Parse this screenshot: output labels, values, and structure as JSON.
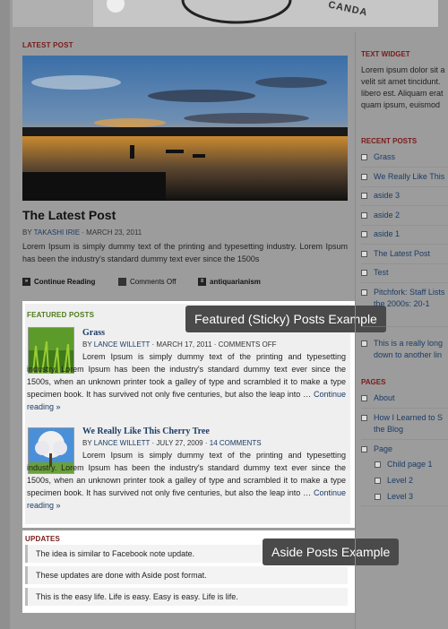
{
  "masthead": {
    "text": "CANDA"
  },
  "main": {
    "latest_label": "LATEST POST",
    "post": {
      "title": "The Latest Post",
      "by": "BY",
      "author": "TAKASHI IRIE",
      "date": "· MARCH 23, 2011",
      "excerpt": "Lorem Ipsum is simply dummy text of the printing and typesetting industry. Lorem Ipsum has been the industry's standard dummy text ever since the 1500s",
      "actions": {
        "continue": "Continue Reading",
        "comments": "Comments Off",
        "tag": "antiquarianism"
      }
    },
    "featured": {
      "label": "FEATURED POSTS",
      "callout": "Featured (Sticky) Posts Example",
      "items": [
        {
          "title": "Grass",
          "by": "BY",
          "author": "LANCE WILLETT",
          "date": "· MARCH 17, 2011 ·",
          "comments": "COMMENTS OFF",
          "text": "Lorem Ipsum is simply dummy text of the printing and typesetting industry. Lorem Ipsum has been the industry's standard dummy text ever since the 1500s, when an unknown printer took a galley of type and scrambled it to make a type specimen book. It has survived not only five centuries, but also the leap into …",
          "more": "Continue reading »"
        },
        {
          "title": "We Really Like This Cherry Tree",
          "by": "BY",
          "author": "LANCE WILLETT",
          "date": "· JULY 27, 2009 ·",
          "comments": "14 COMMENTS",
          "text": "Lorem Ipsum is simply dummy text of the printing and typesetting industry. Lorem Ipsum has been the industry's standard dummy text ever since the 1500s, when an unknown printer took a galley of type and scrambled it to make a type specimen book. It has survived not only five centuries, but also the leap into …",
          "more": "Continue reading »"
        }
      ]
    },
    "updates": {
      "label": "UPDATES",
      "callout": "Aside Posts Example",
      "items": [
        "The idea is similar to Facebook note update.",
        "These updates are done with Aside post format.",
        "This is the easy life. Life is easy. Easy is easy. Life is life."
      ]
    }
  },
  "sidebar": {
    "text_widget": {
      "label": "TEXT WIDGET",
      "text": "Lorem ipsum dolor sit a velit sit amet tincidunt. libero est. Aliquam erat quam ipsum, euismod"
    },
    "recent": {
      "label": "RECENT POSTS",
      "items": [
        "Grass",
        "We Really Like This",
        "aside 3",
        "aside 2",
        "aside 1",
        "The Latest Post",
        "Test",
        "Pitchfork: Staff Lists",
        "the 2000s: 20-1",
        "This is a really long",
        "down to another lin"
      ]
    },
    "pages": {
      "label": "PAGES",
      "items": [
        "About",
        "How I Learned to S",
        "the Blog",
        "Page",
        "Child page 1",
        "Level 2",
        "Level 3"
      ]
    }
  }
}
